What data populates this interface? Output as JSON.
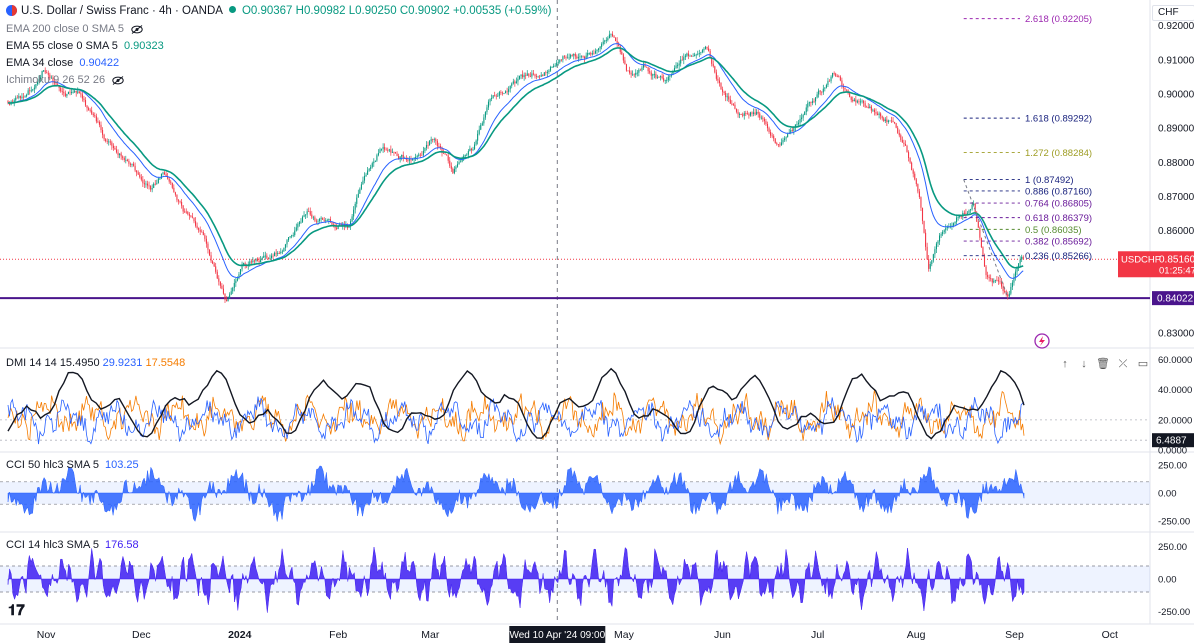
{
  "legend": {
    "title": "U.S. Dollar / Swiss Franc · 4h · OANDA",
    "ohlc": "O0.90367 H0.90982 L0.90250 C0.90902 +0.00535 (+0.59%)",
    "indicators": [
      {
        "label": "EMA 200 close 0 SMA 5",
        "value": "",
        "color": "#787b86",
        "muted": true
      },
      {
        "label": "EMA 55 close 0 SMA 5",
        "value": "0.90323",
        "color": "#089981"
      },
      {
        "label": "EMA 34 close",
        "value": "0.90422",
        "color": "#2962ff"
      },
      {
        "label": "Ichimoku 9 26 52 26",
        "value": "",
        "color": "#787b86",
        "muted": true
      }
    ]
  },
  "currency": "CHF",
  "panes": {
    "dmi_legend": {
      "label": "DMI 14 14",
      "v1": "15.4950",
      "v2": "29.9231",
      "v3": "17.5548"
    },
    "cci50_legend": {
      "label": "CCI 50 hlc3 SMA 5",
      "value": "103.25"
    },
    "cci14_legend": {
      "label": "CCI 14 hlc3 SMA 5",
      "value": "176.58"
    }
  },
  "crosshair_label": "Wed 10 Apr '24   09:00",
  "colors": {
    "up": "#089981",
    "down": "#f23645",
    "ema55": "#089981",
    "ema34": "#2962ff",
    "support": "#4a148c",
    "dmi_adx": "#131722",
    "dmi_plus": "#2962ff",
    "dmi_minus": "#f57c00",
    "cci50": "#2962ff",
    "cci14": "#3d1cf2"
  },
  "chart_data": {
    "type": "candlestick",
    "title": "U.S. Dollar / Swiss Franc · 4h · OANDA",
    "x_ticks": [
      "Nov",
      "Dec",
      "2024",
      "Feb",
      "Mar",
      "May",
      "Jun",
      "Jul",
      "Aug",
      "Sep",
      "Oct"
    ],
    "y_ticks": [
      0.92,
      0.91,
      0.9,
      0.89,
      0.88,
      0.87,
      0.86,
      0.85,
      0.84,
      0.83
    ],
    "ylim": [
      0.8265,
      0.9275
    ],
    "price_path": [
      {
        "t": "2023-10-20",
        "p": 0.898
      },
      {
        "t": "2023-10-26",
        "p": 0.9
      },
      {
        "t": "2023-10-31",
        "p": 0.908
      },
      {
        "t": "2023-11-05",
        "p": 0.901
      },
      {
        "t": "2023-11-12",
        "p": 0.899
      },
      {
        "t": "2023-11-20",
        "p": 0.886
      },
      {
        "t": "2023-11-28",
        "p": 0.879
      },
      {
        "t": "2023-12-04",
        "p": 0.873
      },
      {
        "t": "2023-12-08",
        "p": 0.878
      },
      {
        "t": "2023-12-14",
        "p": 0.866
      },
      {
        "t": "2023-12-20",
        "p": 0.86
      },
      {
        "t": "2023-12-28",
        "p": 0.839
      },
      {
        "t": "2024-01-02",
        "p": 0.85
      },
      {
        "t": "2024-01-10",
        "p": 0.852
      },
      {
        "t": "2024-01-16",
        "p": 0.857
      },
      {
        "t": "2024-01-22",
        "p": 0.866
      },
      {
        "t": "2024-01-28",
        "p": 0.862
      },
      {
        "t": "2024-02-04",
        "p": 0.86
      },
      {
        "t": "2024-02-08",
        "p": 0.873
      },
      {
        "t": "2024-02-14",
        "p": 0.884
      },
      {
        "t": "2024-02-20",
        "p": 0.882
      },
      {
        "t": "2024-02-26",
        "p": 0.88
      },
      {
        "t": "2024-03-02",
        "p": 0.887
      },
      {
        "t": "2024-03-08",
        "p": 0.877
      },
      {
        "t": "2024-03-14",
        "p": 0.883
      },
      {
        "t": "2024-03-20",
        "p": 0.898
      },
      {
        "t": "2024-03-26",
        "p": 0.903
      },
      {
        "t": "2024-04-01",
        "p": 0.905
      },
      {
        "t": "2024-04-06",
        "p": 0.907
      },
      {
        "t": "2024-04-12",
        "p": 0.912
      },
      {
        "t": "2024-04-17",
        "p": 0.91
      },
      {
        "t": "2024-04-23",
        "p": 0.912
      },
      {
        "t": "2024-04-27",
        "p": 0.918
      },
      {
        "t": "2024-05-02",
        "p": 0.906
      },
      {
        "t": "2024-05-07",
        "p": 0.908
      },
      {
        "t": "2024-05-14",
        "p": 0.904
      },
      {
        "t": "2024-05-20",
        "p": 0.91
      },
      {
        "t": "2024-05-27",
        "p": 0.914
      },
      {
        "t": "2024-06-01",
        "p": 0.901
      },
      {
        "t": "2024-06-07",
        "p": 0.893
      },
      {
        "t": "2024-06-12",
        "p": 0.895
      },
      {
        "t": "2024-06-18",
        "p": 0.885
      },
      {
        "t": "2024-06-24",
        "p": 0.891
      },
      {
        "t": "2024-07-01",
        "p": 0.9
      },
      {
        "t": "2024-07-06",
        "p": 0.905
      },
      {
        "t": "2024-07-12",
        "p": 0.898
      },
      {
        "t": "2024-07-18",
        "p": 0.895
      },
      {
        "t": "2024-07-24",
        "p": 0.892
      },
      {
        "t": "2024-07-30",
        "p": 0.881
      },
      {
        "t": "2024-08-02",
        "p": 0.87
      },
      {
        "t": "2024-08-05",
        "p": 0.848
      },
      {
        "t": "2024-08-09",
        "p": 0.859
      },
      {
        "t": "2024-08-14",
        "p": 0.864
      },
      {
        "t": "2024-08-19",
        "p": 0.868
      },
      {
        "t": "2024-08-23",
        "p": 0.848
      },
      {
        "t": "2024-08-27",
        "p": 0.844
      },
      {
        "t": "2024-08-30",
        "p": 0.84
      },
      {
        "t": "2024-09-03",
        "p": 0.851
      },
      {
        "t": "2024-09-04",
        "p": 0.8516
      }
    ],
    "last_price": {
      "symbol": "USDCHF",
      "value": "0.85160",
      "countdown": "01:25:47"
    },
    "support_line": {
      "value": 0.84022,
      "label": "0.84022"
    },
    "fibonacci": [
      {
        "level": "2.618",
        "value": 0.92205,
        "label": "2.618 (0.92205)",
        "color": "#9c27b0"
      },
      {
        "level": "1.618",
        "value": 0.89292,
        "label": "1.618 (0.89292)",
        "color": "#1a237e"
      },
      {
        "level": "1.272",
        "value": 0.88284,
        "label": "1.272 (0.88284)",
        "color": "#9e9d24"
      },
      {
        "level": "1",
        "value": 0.87492,
        "label": "1 (0.87492)",
        "color": "#1a237e"
      },
      {
        "level": "0.886",
        "value": 0.8716,
        "label": "0.886 (0.87160)",
        "color": "#1a237e"
      },
      {
        "level": "0.764",
        "value": 0.86805,
        "label": "0.764 (0.86805)",
        "color": "#6a1b9a"
      },
      {
        "level": "0.618",
        "value": 0.86379,
        "label": "0.618 (0.86379)",
        "color": "#6a1b9a"
      },
      {
        "level": "0.5",
        "value": 0.86035,
        "label": "0.5 (0.86035)",
        "color": "#558b2f"
      },
      {
        "level": "0.382",
        "value": 0.85692,
        "label": "0.382 (0.85692)",
        "color": "#6a1b9a"
      },
      {
        "level": "0.236",
        "value": 0.85266,
        "label": "0.236 (0.85266)",
        "color": "#1a237e"
      }
    ],
    "fib_anchor": {
      "high": {
        "t": "2024-08-16",
        "p": 0.87492
      },
      "low": {
        "t": "2024-08-30",
        "p": 0.84022
      }
    },
    "dmi": {
      "title": "DMI 14 14",
      "values": [
        15.495,
        29.9231,
        17.5548
      ],
      "y_ticks": [
        "60.0000",
        "40.0000",
        "20.0000",
        "0.0000"
      ],
      "ylim": [
        0,
        65
      ],
      "current_label": "6.4887"
    },
    "cci50": {
      "title": "CCI 50 hlc3 SMA 5",
      "value": 103.25,
      "y_ticks": [
        "250.00",
        "0.00",
        "-250.00"
      ],
      "band": [
        -100,
        100
      ],
      "ylim": [
        -330,
        330
      ]
    },
    "cci14": {
      "title": "CCI 14 hlc3 SMA 5",
      "value": 176.58,
      "y_ticks": [
        "250.00",
        "0.00",
        "-250.00"
      ],
      "band": [
        -100,
        100
      ],
      "ylim": [
        -330,
        330
      ]
    }
  }
}
